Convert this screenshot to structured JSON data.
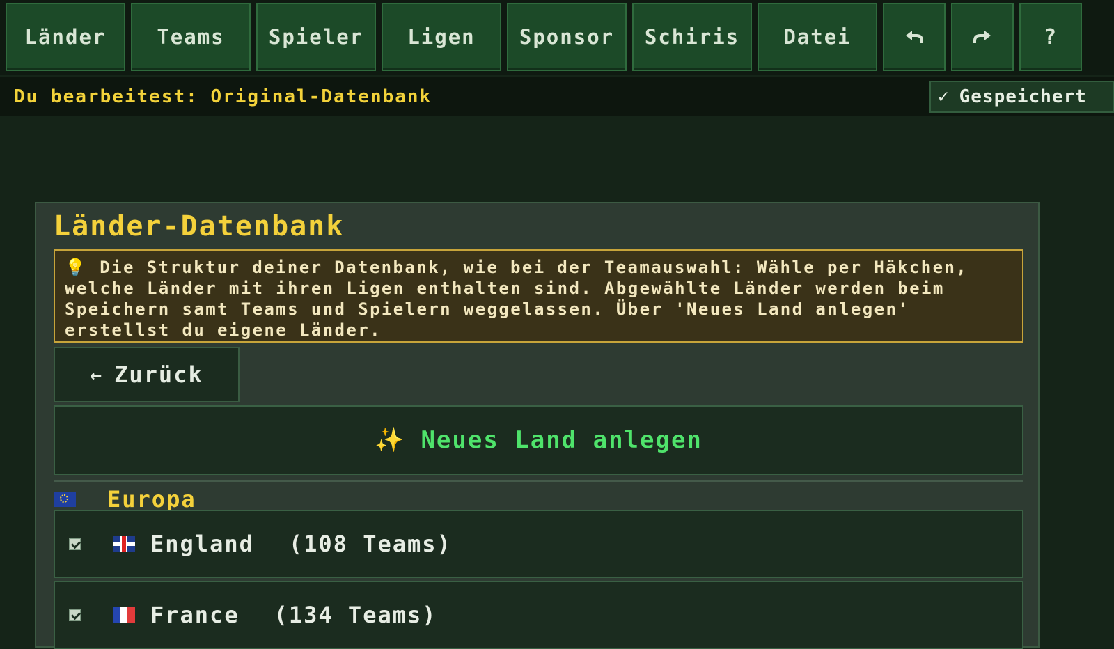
{
  "nav": {
    "items": [
      {
        "label": "Länder",
        "name": "nav-laender-button"
      },
      {
        "label": "Teams",
        "name": "nav-teams-button"
      },
      {
        "label": "Spieler",
        "name": "nav-spieler-button"
      },
      {
        "label": "Ligen",
        "name": "nav-ligen-button"
      },
      {
        "label": "Sponsor",
        "name": "nav-sponsor-button"
      },
      {
        "label": "Schiris",
        "name": "nav-schiris-button"
      },
      {
        "label": "Datei",
        "name": "nav-datei-button"
      }
    ],
    "undo_icon": "undo-icon",
    "redo_icon": "redo-icon",
    "help_label": "?"
  },
  "status": {
    "editing_text": "Du bearbeitest: Original-Datenbank",
    "saved_label": "Gespeichert",
    "saved_icon": "checkmark-icon"
  },
  "panel": {
    "title": "Länder-Datenbank",
    "info_text": "Die Struktur deiner Datenbank, wie bei der Teamauswahl: Wähle per Häkchen, welche Länder mit ihren Ligen enthalten sind. Abgewählte Länder werden beim Speichern samt Teams und Spielern weggelassen. Über 'Neues Land anlegen' erstellst du eigene Länder.",
    "info_icon": "lightbulb-icon",
    "back_label": "Zurück",
    "new_country_label": "Neues Land anlegen",
    "new_country_icon": "sparkles-icon"
  },
  "regions": [
    {
      "label": "Europa",
      "flag": "eu-flag-icon",
      "countries": [
        {
          "name": "England",
          "teams": "(108 Teams)",
          "checked": true,
          "flag": "uk-flag-icon"
        },
        {
          "name": "France",
          "teams": "(134 Teams)",
          "checked": true,
          "flag": "france-flag-icon"
        }
      ]
    }
  ],
  "colors": {
    "accent_yellow": "#f4d13b",
    "accent_green": "#4fe36b",
    "nav_bg": "#1c4a28",
    "page_bg": "#152418"
  }
}
